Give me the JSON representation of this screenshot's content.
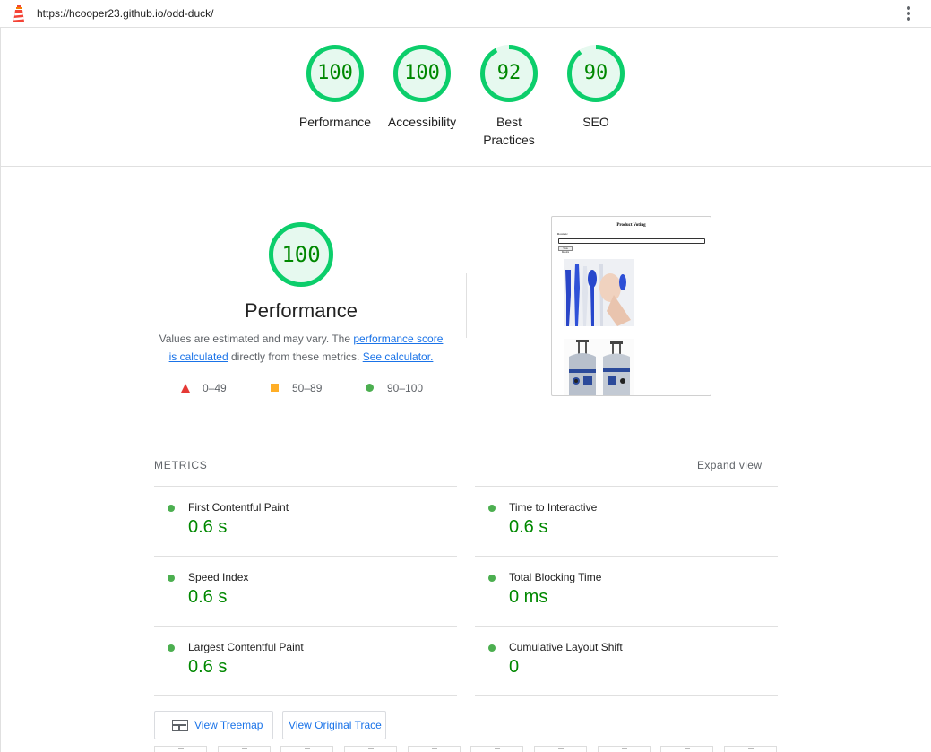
{
  "browser": {
    "url": "https://hcooper23.github.io/odd-duck/"
  },
  "categories": [
    {
      "score": "100",
      "label": "Performance",
      "value": 100
    },
    {
      "score": "100",
      "label": "Accessibility",
      "value": 100
    },
    {
      "score": "92",
      "label": "Best Practices",
      "value": 92
    },
    {
      "score": "90",
      "label": "SEO",
      "value": 90
    }
  ],
  "performance": {
    "score": "100",
    "title": "Performance",
    "desc_prefix": "Values are estimated and may vary. The ",
    "link_score": "performance score is calculated",
    "desc_middle": " directly from these metrics. ",
    "link_calc": "See calculator.",
    "legend": [
      {
        "range": "0–49",
        "shape": "triangle",
        "color": "#e53935"
      },
      {
        "range": "50–89",
        "shape": "square",
        "color": "#ffa000"
      },
      {
        "range": "90–100",
        "shape": "circle",
        "color": "#4caf50"
      }
    ]
  },
  "screenshot": {
    "page_title": "Product Voting",
    "field_label": "Rounds:",
    "button_label": "View Results"
  },
  "metrics": {
    "heading": "METRICS",
    "expand_label": "Expand view",
    "items": [
      {
        "label": "First Contentful Paint",
        "value": "0.6 s"
      },
      {
        "label": "Time to Interactive",
        "value": "0.6 s"
      },
      {
        "label": "Speed Index",
        "value": "0.6 s"
      },
      {
        "label": "Total Blocking Time",
        "value": "0 ms"
      },
      {
        "label": "Largest Contentful Paint",
        "value": "0.6 s"
      },
      {
        "label": "Cumulative Layout Shift",
        "value": "0"
      }
    ]
  },
  "buttons": {
    "treemap": "View Treemap",
    "trace": "View Original Trace"
  },
  "colors": {
    "pass": "#0cce6b",
    "pass_text": "#008800",
    "link": "#1a73e8"
  },
  "icons": {
    "logo": "lighthouse-icon",
    "menu": "more-vertical-icon",
    "treemap": "treemap-icon"
  }
}
